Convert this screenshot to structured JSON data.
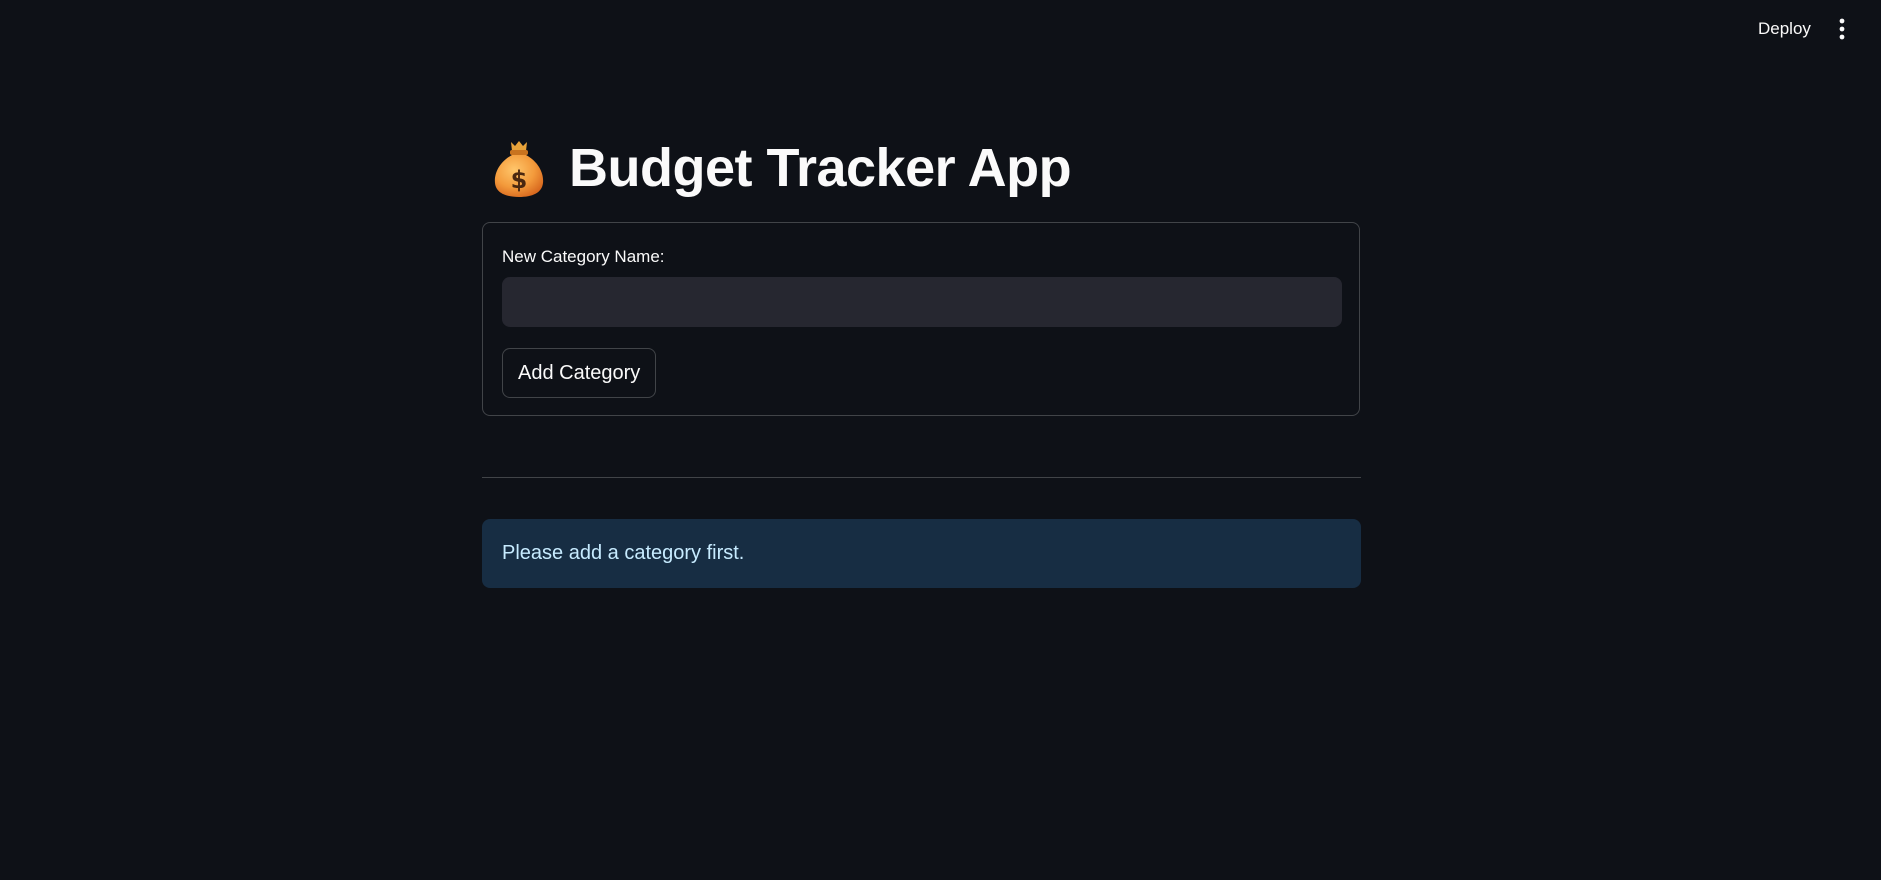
{
  "header": {
    "deploy_label": "Deploy",
    "menu_icon": "vertical-dots-icon"
  },
  "app": {
    "title_icon": "money-bag-icon",
    "title": "Budget Tracker App"
  },
  "form": {
    "label": "New Category Name:",
    "input_value": "",
    "input_placeholder": "",
    "submit_label": "Add Category"
  },
  "alert": {
    "type": "info",
    "message": "Please add a category first."
  },
  "colors": {
    "background": "#0e1117",
    "input_background": "#262730",
    "info_background": "#172d43",
    "info_text": "#c7ebff",
    "text": "#fafafa"
  }
}
